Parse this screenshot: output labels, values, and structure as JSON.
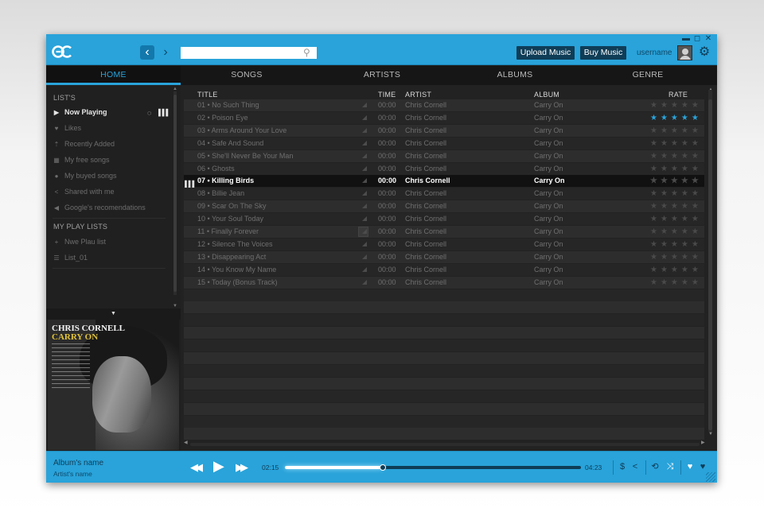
{
  "top": {
    "search_placeholder": "",
    "upload_label": "Upload Music",
    "buy_label": "Buy Music",
    "username": "username",
    "nav_back": "‹",
    "nav_forward": "›",
    "window_min": "▬",
    "window_max": "◻",
    "window_close": "✕"
  },
  "tabs": [
    {
      "label": "HOME",
      "active": true
    },
    {
      "label": "SONGS",
      "active": false
    },
    {
      "label": "ARTISTS",
      "active": false
    },
    {
      "label": "ALBUMS",
      "active": false
    },
    {
      "label": "GENRE",
      "active": false
    }
  ],
  "sidebar": {
    "lists_title": "LIST'S",
    "lists": [
      {
        "label": "Now Playing",
        "icon": "play-icon",
        "active": true
      },
      {
        "label": "Likes",
        "icon": "heart-icon",
        "active": false
      },
      {
        "label": "Recently Added",
        "icon": "upload-icon",
        "active": false
      },
      {
        "label": "My free songs",
        "icon": "gift-icon",
        "active": false
      },
      {
        "label": "My buyed songs",
        "icon": "dollar-icon",
        "active": false
      },
      {
        "label": "Shared with me",
        "icon": "share-icon",
        "active": false
      },
      {
        "label": "Google's recomendations",
        "icon": "megaphone-icon",
        "active": false
      }
    ],
    "playlists_title": "MY PLAY LISTS",
    "playlists": [
      {
        "label": "Nwe Plau list",
        "icon": "plus-icon"
      },
      {
        "label": "List_01",
        "icon": "list-icon"
      }
    ]
  },
  "album_cover": {
    "artist_text": "CHRIS CORNELL",
    "album_text": "CARRY ON"
  },
  "table": {
    "headers": {
      "title": "TITLE",
      "time": "TIME",
      "artist": "ARTIST",
      "album": "ALBUM",
      "rate": "RATE"
    },
    "rows": [
      {
        "title": "01 • No Such Thing",
        "time": "00:00",
        "artist": "Chris Cornell",
        "album": "Carry On",
        "rating": 0
      },
      {
        "title": "02 • Poison Eye",
        "time": "00:00",
        "artist": "Chris Cornell",
        "album": "Carry On",
        "rating": 5
      },
      {
        "title": "03 • Arms Around Your Love",
        "time": "00:00",
        "artist": "Chris Cornell",
        "album": "Carry On",
        "rating": 0
      },
      {
        "title": "04 • Safe And Sound",
        "time": "00:00",
        "artist": "Chris Cornell",
        "album": "Carry On",
        "rating": 0
      },
      {
        "title": "05 • She'll Never Be Your Man",
        "time": "00:00",
        "artist": "Chris Cornell",
        "album": "Carry On",
        "rating": 0
      },
      {
        "title": "06 • Ghosts",
        "time": "00:00",
        "artist": "Chris Cornell",
        "album": "Carry On",
        "rating": 0
      },
      {
        "title": "07 • Killing Birds",
        "time": "00:00",
        "artist": "Chris Cornell",
        "album": "Carry On",
        "rating": 0,
        "playing": true
      },
      {
        "title": "08 • Billie Jean",
        "time": "00:00",
        "artist": "Chris Cornell",
        "album": "Carry On",
        "rating": 0
      },
      {
        "title": "09 • Scar On The Sky",
        "time": "00:00",
        "artist": "Chris Cornell",
        "album": "Carry On",
        "rating": 0
      },
      {
        "title": "10 • Your Soul Today",
        "time": "00:00",
        "artist": "Chris Cornell",
        "album": "Carry On",
        "rating": 0
      },
      {
        "title": "11 • Finally Forever",
        "time": "00:00",
        "artist": "Chris Cornell",
        "album": "Carry On",
        "rating": 0,
        "hovered": true
      },
      {
        "title": "12 • Silence The Voices",
        "time": "00:00",
        "artist": "Chris Cornell",
        "album": "Carry On",
        "rating": 0
      },
      {
        "title": "13 • Disappearing Act",
        "time": "00:00",
        "artist": "Chris Cornell",
        "album": "Carry On",
        "rating": 0
      },
      {
        "title": "14 • You Know My Name",
        "time": "00:00",
        "artist": "Chris Cornell",
        "album": "Carry On",
        "rating": 0
      },
      {
        "title": "15 • Today (Bonus Track)",
        "time": "00:00",
        "artist": "Chris Cornell",
        "album": "Carry On",
        "rating": 0
      }
    ]
  },
  "player": {
    "album_name": "Album's name",
    "artist_name": "Artist's name",
    "current_time": "02:15",
    "total_time": "04:23",
    "progress": 0.33
  },
  "colors": {
    "accent": "#29a3da",
    "dark_accent": "#0f3d57"
  }
}
